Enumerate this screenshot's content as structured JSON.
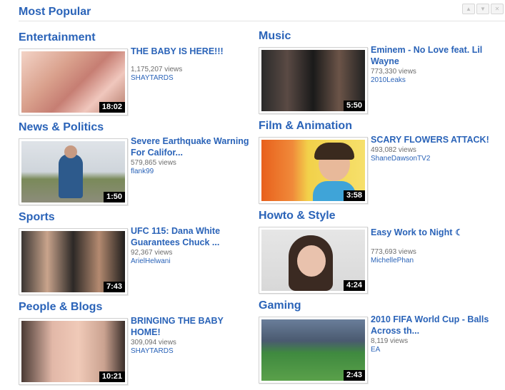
{
  "header": {
    "title": "Most Popular"
  },
  "sections": [
    {
      "category": "Entertainment",
      "title": "THE BABY IS HERE!!!",
      "views": "1,175,207 views",
      "user": "SHAYTARDS",
      "duration": "18:02"
    },
    {
      "category": "Music",
      "title": "Eminem - No Love feat. Lil Wayne",
      "views": "773,330 views",
      "user": "2010Leaks",
      "duration": "5:50"
    },
    {
      "category": "News & Politics",
      "title": "Severe Earthquake Warning For Califor...",
      "views": "579,865 views",
      "user": "flank99",
      "duration": "1:50"
    },
    {
      "category": "Film & Animation",
      "title": "SCARY FLOWERS ATTACK!",
      "views": "493,082 views",
      "user": "ShaneDawsonTV2",
      "duration": "3:58"
    },
    {
      "category": "Sports",
      "title": "UFC 115: Dana White Guarantees Chuck ...",
      "views": "92,367 views",
      "user": "ArielHelwani",
      "duration": "7:43"
    },
    {
      "category": "Howto & Style",
      "title": "Easy Work to Night",
      "views": "773,693 views",
      "user": "MichellePhan",
      "duration": "4:24"
    },
    {
      "category": "People & Blogs",
      "title": "BRINGING THE BABY HOME!",
      "views": "309,094 views",
      "user": "SHAYTARDS",
      "duration": "10:21"
    },
    {
      "category": "Gaming",
      "title": "2010 FIFA World Cup - Balls Across th...",
      "views": "8,119 views",
      "user": "EA",
      "duration": "2:43"
    }
  ]
}
